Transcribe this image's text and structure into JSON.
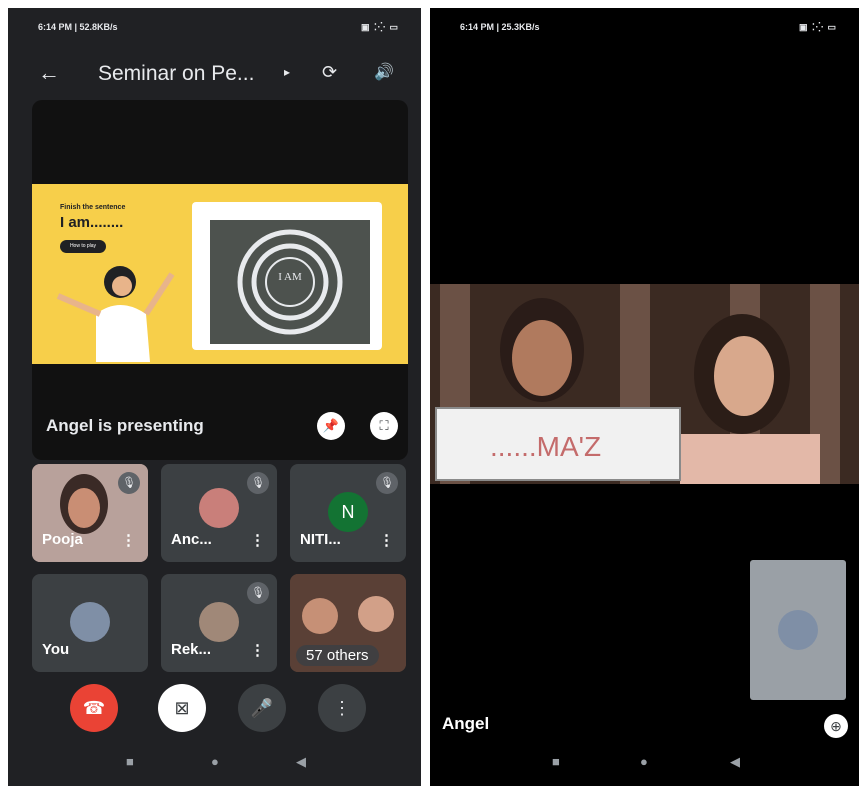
{
  "left": {
    "status": {
      "time": "6:14 PM | 52.8KB/s",
      "icons": "▣ ⁚⁛ ▭"
    },
    "header": {
      "back_icon": "←",
      "title": "Seminar on Pe...",
      "caret": "▸",
      "switch_camera_icon": "⟳",
      "audio_icon": "🔊"
    },
    "slide": {
      "heading": "Finish the sentence",
      "text": "I am........",
      "button": "How to play",
      "board_text": "I AM"
    },
    "presenting_label": "Angel is presenting",
    "pin_icon": "📌",
    "fullscreen_icon": "⛶",
    "participants": [
      {
        "name": "Pooja",
        "dots": "⋮",
        "mute_icon": "🎙"
      },
      {
        "name": "Anc...",
        "dots": "⋮",
        "mute_icon": "🎙"
      },
      {
        "name": "NITI...",
        "initial": "N",
        "dots": "⋮",
        "mute_icon": "🎙"
      },
      {
        "name": "You"
      },
      {
        "name": "Rek...",
        "dots": "⋮",
        "mute_icon": "🎙"
      },
      {
        "name": "57 others"
      }
    ],
    "controls": {
      "end_icon": "☎",
      "camera_icon": "⊠",
      "mic_icon": "🎤",
      "more_icon": "⋮"
    },
    "nav": {
      "square": "■",
      "circle": "●",
      "back": "◀"
    }
  },
  "right": {
    "status": {
      "time": "6:14 PM | 25.3KB/s",
      "icons": "▣ ⁚⁛ ▭"
    },
    "board_text": "......MA'Z",
    "speaker_label": "Angel",
    "layout_icon": "⊕",
    "nav": {
      "square": "■",
      "circle": "●",
      "back": "◀"
    }
  },
  "colors": {
    "end_call": "#ea4335",
    "bg": "#202124",
    "slide": "#f7cf4a"
  }
}
